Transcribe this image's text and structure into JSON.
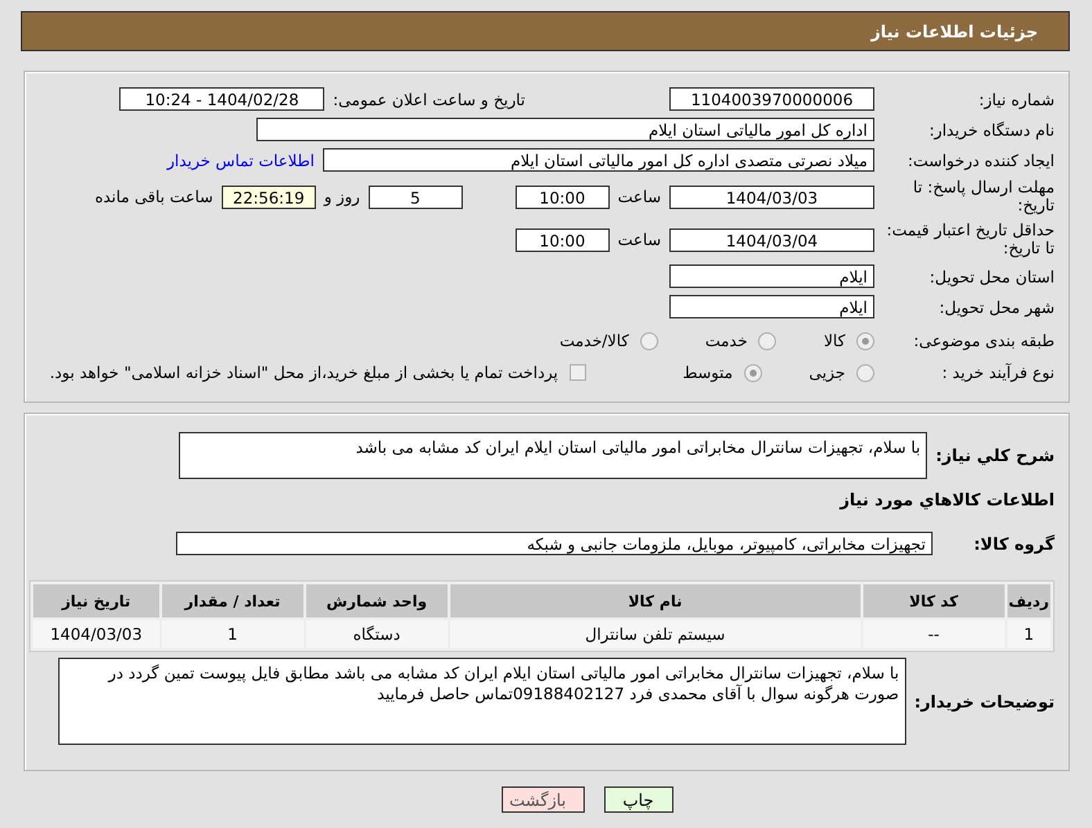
{
  "header": {
    "title": "جزئیات اطلاعات نیاز"
  },
  "need_number": {
    "label": "شماره نیاز:",
    "value": "1104003970000006"
  },
  "announce": {
    "label": "تاریخ و ساعت اعلان عمومی:",
    "value": "1404/02/28 - 10:24"
  },
  "buyer_org": {
    "label": "نام دستگاه خریدار:",
    "value": "اداره کل امور مالیاتی استان ایلام"
  },
  "requester": {
    "label": "ایجاد کننده درخواست:",
    "value": "میلاد نصرتی متصدی اداره کل امور مالیاتی استان ایلام",
    "contact_link": "اطلاعات تماس خریدار"
  },
  "reply_deadline": {
    "label": "مهلت ارسال پاسخ: تا تاریخ:",
    "date": "1404/03/03",
    "time_label": "ساعت",
    "time": "10:00",
    "days": "5",
    "days_label": "روز و",
    "remaining": "22:56:19",
    "remaining_label": "ساعت باقی مانده"
  },
  "price_validity": {
    "label": "حداقل تاریخ اعتبار قیمت: تا تاریخ:",
    "date": "1404/03/04",
    "time_label": "ساعت",
    "time": "10:00"
  },
  "province": {
    "label": "استان محل تحویل:",
    "value": "ایلام"
  },
  "city": {
    "label": "شهر محل تحویل:",
    "value": "ایلام"
  },
  "category": {
    "label": "طبقه بندی موضوعی:",
    "options": [
      {
        "label": "کالا",
        "selected": true
      },
      {
        "label": "خدمت",
        "selected": false
      },
      {
        "label": "کالا/خدمت",
        "selected": false
      }
    ]
  },
  "process": {
    "label": "نوع فرآیند خرید :",
    "options": [
      {
        "label": "جزیی",
        "selected": false
      },
      {
        "label": "متوسط",
        "selected": true
      }
    ],
    "payment_note": {
      "checked": false,
      "text": "پرداخت تمام یا بخشی از مبلغ خرید،از محل \"اسناد خزانه اسلامی\" خواهد بود."
    }
  },
  "description": {
    "label": "شرح کلي نیاز:",
    "value": "با سلام، تجهیزات سانترال مخابراتی امور مالیاتی استان ایلام ایران کد مشابه می باشد"
  },
  "goods_heading": "اطلاعات کالاهاي مورد نياز",
  "goods_group": {
    "label": "گروه کالا:",
    "value": "تجهیزات مخابراتی، کامپیوتر، موبایل، ملزومات جانبی و شبکه"
  },
  "table": {
    "columns": [
      "ردیف",
      "کد کالا",
      "نام کالا",
      "واحد شمارش",
      "تعداد / مقدار",
      "تاریخ نیاز"
    ],
    "rows": [
      [
        "1",
        "--",
        "سیستم تلفن سانترال",
        "دستگاه",
        "1",
        "1404/03/03"
      ]
    ]
  },
  "buyer_notes": {
    "label": "توضیحات خریدار:",
    "value": "با سلام، تجهیزات سانترال مخابراتی امور مالیاتی استان ایلام ایران کد مشابه می باشد مطابق فایل پیوست تمین گردد در صورت هرگونه سوال با آقای محمدی فرد 09188402127تماس حاصل فرمایید"
  },
  "buttons": [
    {
      "label": "چاپ",
      "kind": "print"
    },
    {
      "label": "بازگشت",
      "kind": "back"
    }
  ]
}
